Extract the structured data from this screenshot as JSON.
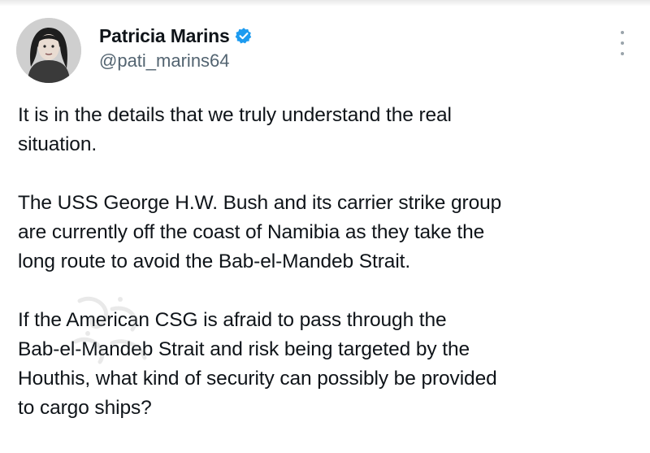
{
  "author": {
    "display_name": "Patricia Marins",
    "handle": "@pati_marins64",
    "verified": true,
    "avatar_icon": "profile-photo",
    "verified_icon": "verified-badge-icon",
    "verified_color": "#1d9bf0"
  },
  "menu": {
    "icon": "more-options-icon"
  },
  "tweet": {
    "paragraphs": [
      "It is in the details that we truly understand the real\nsituation.",
      "The USS George H.W. Bush and its carrier strike group\nare currently off the coast of Namibia as they take the\nlong route to avoid the Bab-el-Mandeb Strait.",
      "If the American CSG is afraid to pass through the\nBab-el-Mandeb Strait and risk being targeted by the\nHouthis, what kind of security can possibly be provided\nto cargo ships?"
    ]
  },
  "colors": {
    "text": "#0f1419",
    "secondary": "#536471",
    "accent": "#1d9bf0"
  }
}
